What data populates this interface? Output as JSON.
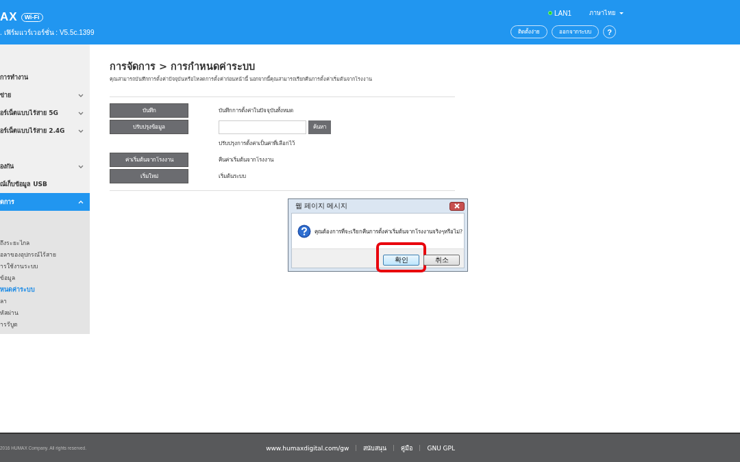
{
  "header": {
    "logo": "AX",
    "logo_badge": "Wi-Fi",
    "firmware": ". เฟิร์มแวร์เวอร์ชั่น : V5.5c.1399",
    "connection": {
      "label": "LAN1",
      "on": true
    },
    "language": "ภาษาไทย",
    "buttons": [
      "ติดตั้งง่าย",
      "ออกจากระบบ"
    ],
    "help": "?"
  },
  "sidebar": {
    "items": [
      {
        "label": "การทำงาน",
        "expandable": false,
        "selected": false
      },
      {
        "label": "ข่าย",
        "expandable": true,
        "expanded": false,
        "selected": false
      },
      {
        "label": "อร์เน็ตแบบไร้สาย 5G",
        "expandable": true,
        "expanded": false,
        "selected": false
      },
      {
        "label": "อร์เน็ตแบบไร้สาย 2.4G",
        "expandable": true,
        "expanded": false,
        "selected": false
      },
      {
        "label": "องกัน",
        "expandable": true,
        "expanded": false,
        "selected": false
      },
      {
        "label": "ณ์เก็บข้อมูล USB",
        "expandable": false,
        "selected": false
      },
      {
        "label": "ดการ",
        "expandable": true,
        "expanded": true,
        "selected": true,
        "children": [
          {
            "label": "ถึงระยะไกล",
            "selected": false
          },
          {
            "label": "อลาของอุปกรณ์ไร้สาย",
            "selected": false
          },
          {
            "label": "ารใช้งานระบบ",
            "selected": false
          },
          {
            "label": "ข้อมูล",
            "selected": false
          },
          {
            "label": "หนดค่าระบบ",
            "selected": true
          },
          {
            "label": "ลา",
            "selected": false
          },
          {
            "label": "หัสผ่าน",
            "selected": false
          },
          {
            "label": "ารรีบูต",
            "selected": false
          }
        ]
      }
    ]
  },
  "page": {
    "title": "การจัดการ > การกำหนดค่าระบบ",
    "description": "คุณสามารถบันทึกการตั้งค่าปัจจุบันหรือโหลดการตั้งค่าก่อนหน้านี้ นอกจากนี้คุณสามารถเรียกคืนการตั้งค่าเริ่มต้นจากโรงงาน",
    "actions": [
      {
        "kind": "text",
        "button": "บันทึก",
        "text": "บันทึกการตั้งค่าในปัจจุบันทั้งหมด"
      },
      {
        "kind": "file",
        "button": "ปรับปรุงข้อมูล",
        "browse": "ค้นหา",
        "text": "ปรับปรุงการตั้งค่าเป็นค่าที่เลือกไว้"
      },
      {
        "kind": "text",
        "button": "ค่าเริ่มต้นจากโรงงาน",
        "text": "คืนค่าเริ่มต้นจากโรงงาน"
      },
      {
        "kind": "text",
        "button": "เริ่มใหม่",
        "text": "เริ่มต้นระบบ"
      }
    ]
  },
  "dialog": {
    "title": "웹 페이지 메시지",
    "message": "คุณต้องการที่จะเรียกคืนการตั้งค่าเริ่มต้นจากโรงงานจริงๆหรือไม่?",
    "buttons": [
      {
        "label": "확인",
        "highlighted": true
      },
      {
        "label": "취소",
        "highlighted": false
      }
    ]
  },
  "footer": {
    "copyright": "2016 HUMAX Company. All rights reserved.",
    "links": [
      "www.humaxdigital.com/gw",
      "สนับสนุน",
      "คู่มือ",
      "GNU GPL"
    ]
  }
}
